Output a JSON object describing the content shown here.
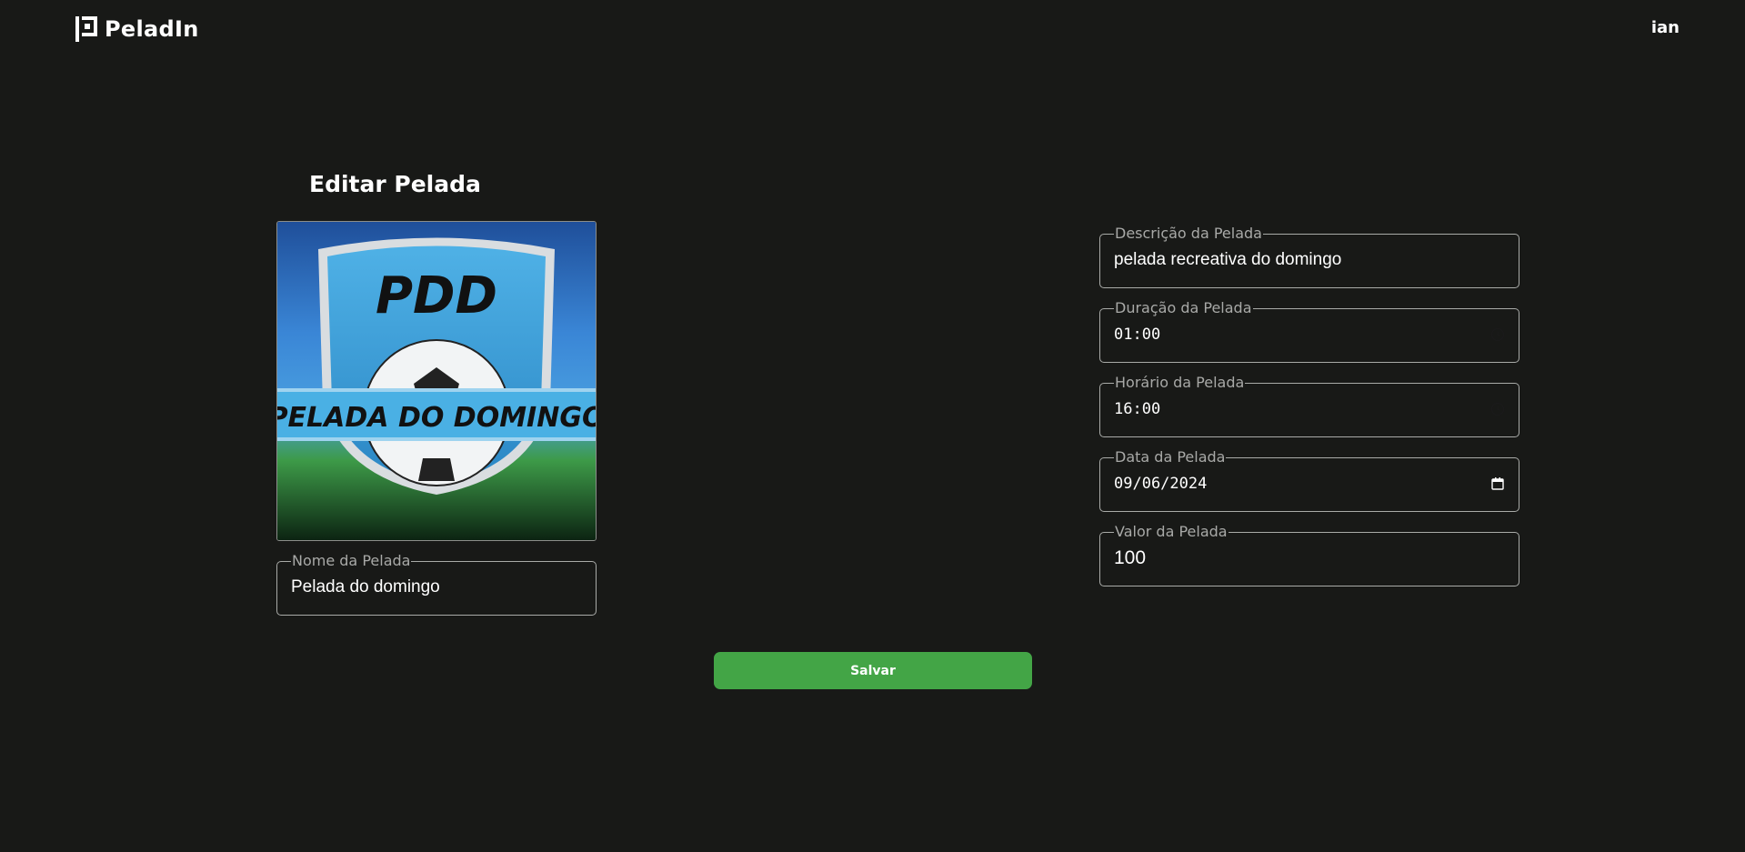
{
  "header": {
    "brand": "PeladIn",
    "user": "ian"
  },
  "page": {
    "title": "Editar Pelada"
  },
  "image": {
    "badge_letters": "PDD",
    "badge_banner": "PELADA DO DOMINGO",
    "colors": {
      "sky": "#2f7fcf",
      "shield": "#3aa0d8",
      "grass": "#2e8a3a"
    }
  },
  "form": {
    "nome": {
      "label": "Nome da Pelada",
      "value": "Pelada do domingo"
    },
    "descricao": {
      "label": "Descrição da Pelada",
      "value": "pelada recreativa do domingo"
    },
    "duracao": {
      "label": "Duração da Pelada",
      "value": "01:00",
      "icon": "clock-icon"
    },
    "horario": {
      "label": "Horário da Pelada",
      "value": "16:00",
      "icon": "clock-icon"
    },
    "data": {
      "label": "Data da Pelada",
      "value": "09/06/2024",
      "icon": "calendar-icon"
    },
    "valor": {
      "label": "Valor da Pelada",
      "value": "100"
    }
  },
  "actions": {
    "save_label": "Salvar",
    "save_color": "#43a546"
  }
}
